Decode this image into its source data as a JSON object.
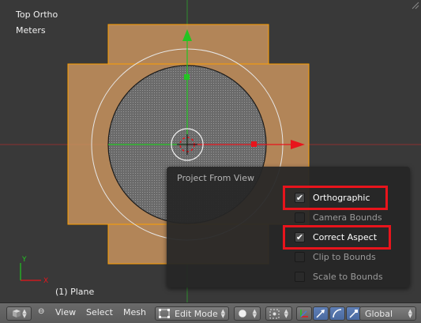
{
  "viewport": {
    "view_name": "Top Ortho",
    "units": "Meters",
    "object_label": "(1) Plane",
    "axis_x": "X",
    "axis_y": "Y"
  },
  "popup": {
    "title": "Project From View",
    "options": [
      {
        "label": "Orthographic",
        "checked": true,
        "highlighted": true
      },
      {
        "label": "Camera Bounds",
        "checked": false,
        "highlighted": false
      },
      {
        "label": "Correct Aspect",
        "checked": true,
        "highlighted": true
      },
      {
        "label": "Clip to Bounds",
        "checked": false,
        "highlighted": false
      },
      {
        "label": "Scale to Bounds",
        "checked": false,
        "highlighted": false
      }
    ]
  },
  "header": {
    "menus": [
      "View",
      "Select",
      "Mesh"
    ],
    "mode": "Edit Mode",
    "orientation": "Global"
  },
  "colors": {
    "highlight": "#e8141c",
    "mesh_face": "#c8935e",
    "edge_selected": "#ffa000",
    "axis_x": "#e8141c",
    "axis_y": "#22c522",
    "selection_blue": "#5a7ab0"
  }
}
